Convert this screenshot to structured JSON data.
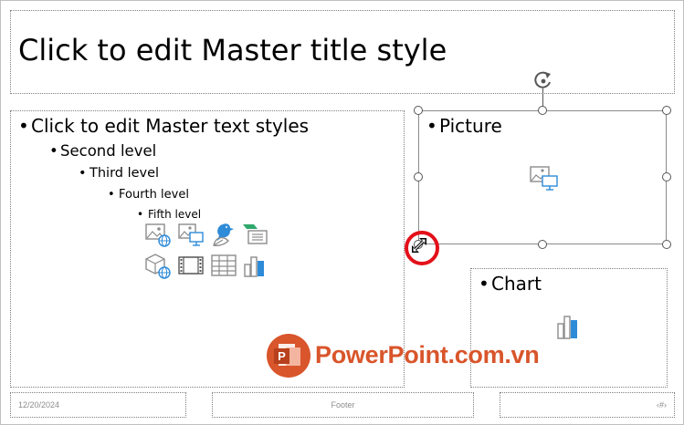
{
  "title": {
    "text": "Click to edit Master title style"
  },
  "content": {
    "level1": "Click to edit Master text styles",
    "level2": "Second level",
    "level3": "Third level",
    "level4": "Fourth level",
    "level5": "Fifth level",
    "insert_icons": [
      "online-picture-icon",
      "picture-icon",
      "icon-insert-icon",
      "smartart-icon",
      "3d-model-icon",
      "video-icon",
      "table-icon",
      "chart-icon"
    ]
  },
  "picture_placeholder": {
    "label": "Picture",
    "icon": "picture-icon"
  },
  "chart_placeholder": {
    "label": "Chart",
    "icon": "chart-icon"
  },
  "footer": {
    "date": "12/20/2024",
    "center": "Footer",
    "number": "‹#›"
  },
  "watermark": {
    "text": "PowerPoint.com.vn",
    "logo_letter": "P"
  },
  "colors": {
    "highlight_circle": "#e3101a",
    "icon_blue": "#2e8bd8",
    "icon_gray": "#8c8c8c",
    "watermark_orange": "#d9552b"
  }
}
